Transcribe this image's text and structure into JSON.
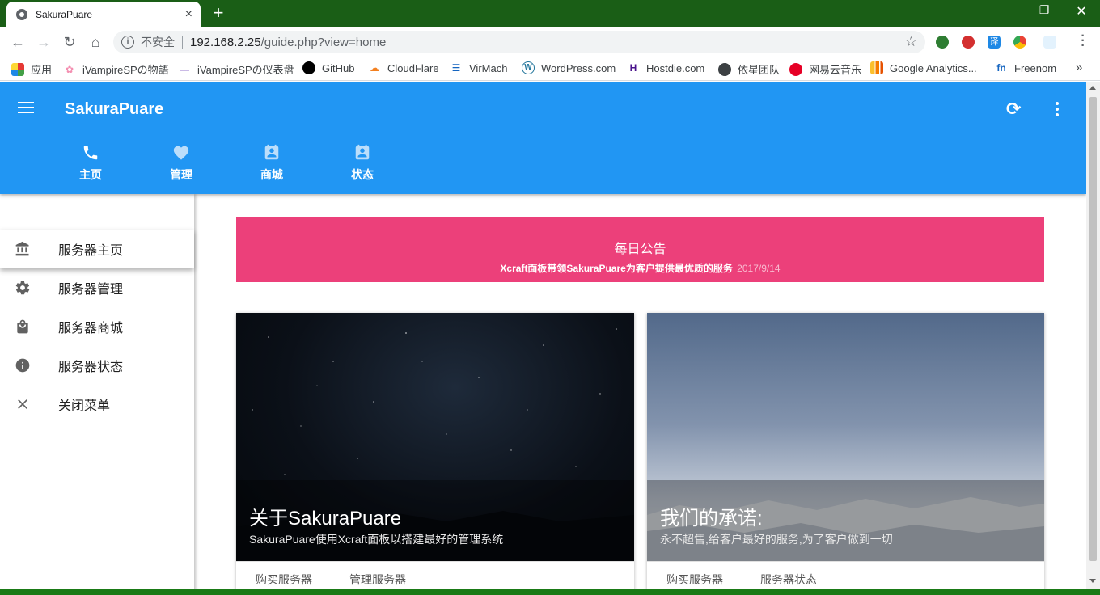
{
  "browser": {
    "tab_title": "SakuraPuare",
    "url_security": "不安全",
    "url_host": "192.168.2.25",
    "url_path": "/guide.php?view=home"
  },
  "bookmarks": [
    {
      "label": "应用",
      "icon": "apps-grid-icon",
      "color": "#e53935"
    },
    {
      "label": "iVampireSPの物語",
      "icon": "sakura-icon",
      "color": "#f48fb1"
    },
    {
      "label": "iVampireSPの仪表盘",
      "icon": "dash-icon",
      "color": "#9575cd"
    },
    {
      "label": "GitHub",
      "icon": "github-icon",
      "color": "#000000"
    },
    {
      "label": "CloudFlare",
      "icon": "cloud-icon",
      "color": "#f38020"
    },
    {
      "label": "VirMach",
      "icon": "server-icon",
      "color": "#1565c0"
    },
    {
      "label": "WordPress.com",
      "icon": "wordpress-icon",
      "color": "#21759b"
    },
    {
      "label": "Hostdie.com",
      "icon": "hostdie-icon",
      "color": "#4a148c"
    },
    {
      "label": "依星团队",
      "icon": "globe-icon",
      "color": "#3c4043"
    },
    {
      "label": "网易云音乐",
      "icon": "netease-music-icon",
      "color": "#e60026"
    },
    {
      "label": "Google Analytics...",
      "icon": "analytics-icon",
      "color": "#f9ab00"
    },
    {
      "label": "Freenom",
      "icon": "freenom-icon",
      "color": "#1565c0"
    }
  ],
  "app": {
    "title": "SakuraPuare",
    "tabs": [
      {
        "label": "主页",
        "icon": "phone-icon"
      },
      {
        "label": "管理",
        "icon": "heart-icon"
      },
      {
        "label": "商城",
        "icon": "contact-card-icon"
      },
      {
        "label": "状态",
        "icon": "contact-card-icon"
      }
    ]
  },
  "sidebar": {
    "items": [
      {
        "label": "服务器主页",
        "icon": "bank-icon"
      },
      {
        "label": "服务器管理",
        "icon": "gear-icon"
      },
      {
        "label": "服务器商城",
        "icon": "shopping-bag-icon"
      },
      {
        "label": "服务器状态",
        "icon": "info-icon"
      },
      {
        "label": "关闭菜单",
        "icon": "close-icon"
      }
    ]
  },
  "notice": {
    "title": "每日公告",
    "body": "Xcraft面板带领SakuraPuare为客户提供最优质的服务",
    "date": "2017/9/14"
  },
  "cards": [
    {
      "title": "关于SakuraPuare",
      "subtitle": "SakuraPuare使用Xcraft面板以搭建最好的管理系统",
      "actions": [
        "购买服务器",
        "管理服务器"
      ]
    },
    {
      "title": "我们的承诺:",
      "subtitle": "永不超售,给客户最好的服务,为了客户做到一切",
      "actions": [
        "购买服务器",
        "服务器状态"
      ]
    }
  ],
  "colors": {
    "appbar": "#2196f3",
    "notice": "#ec407a",
    "tabstrip": "#1a5e16"
  }
}
